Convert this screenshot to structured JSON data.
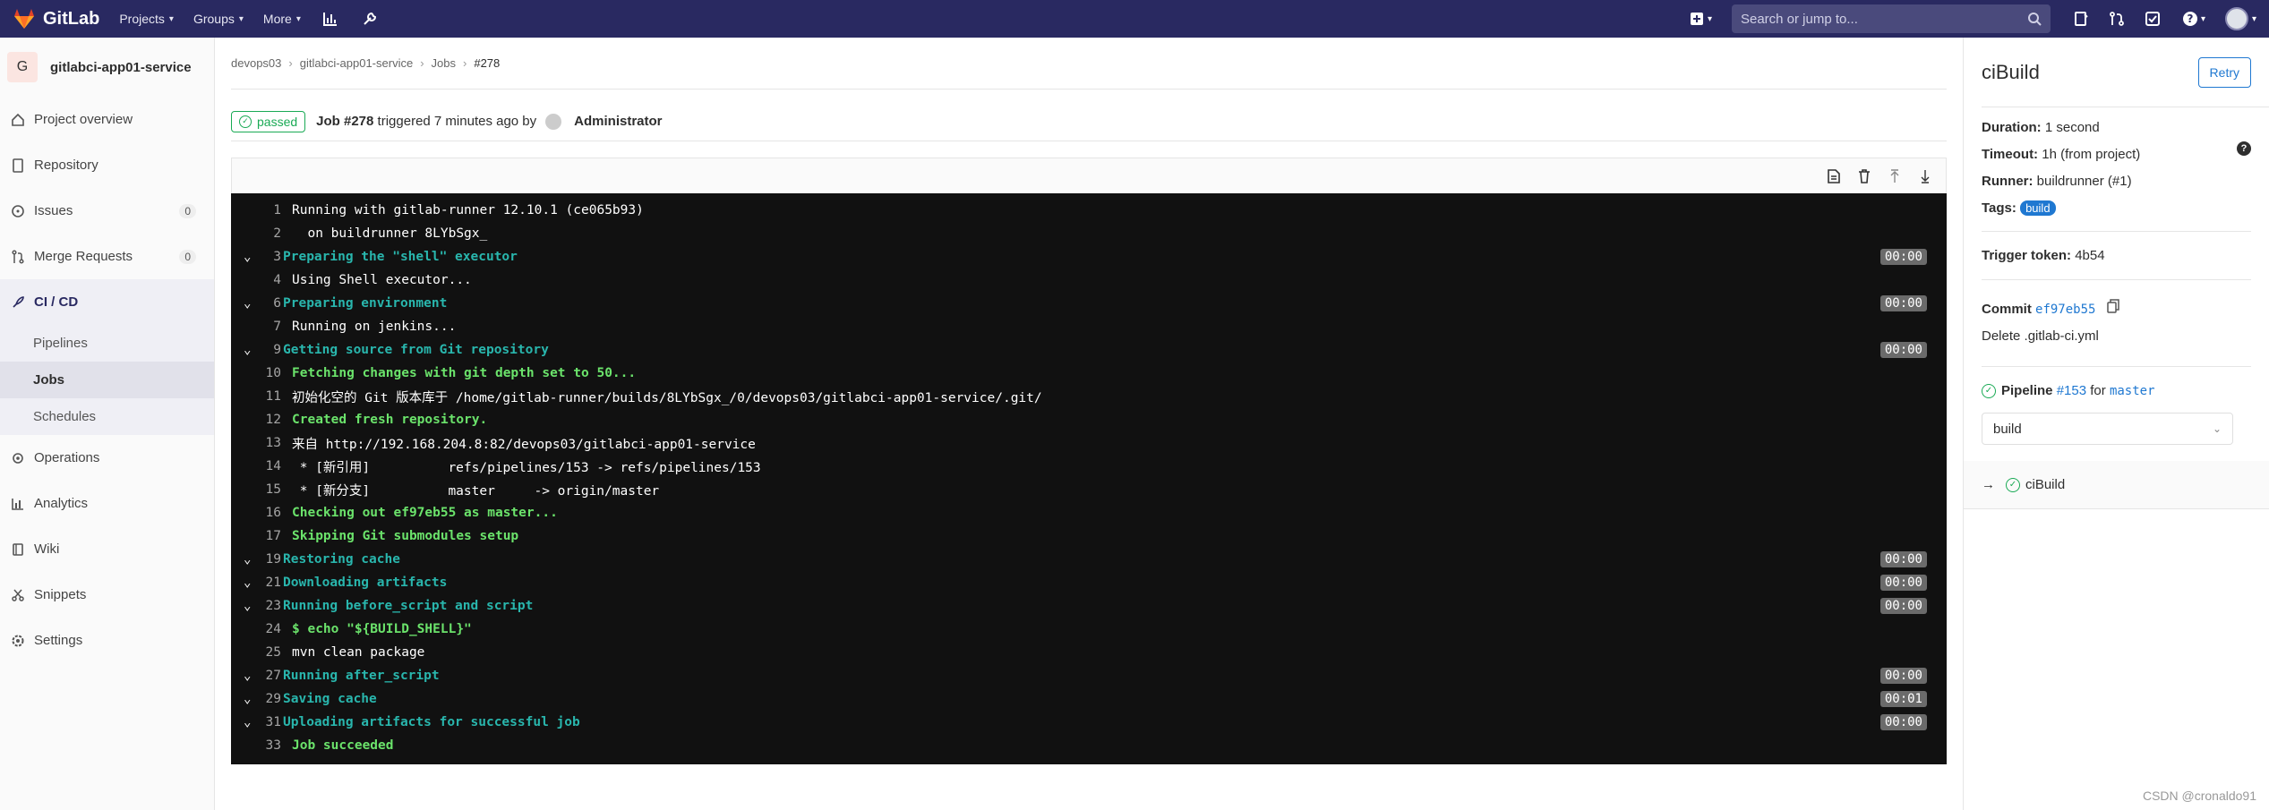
{
  "topbar": {
    "brand": "GitLab",
    "nav": [
      "Projects",
      "Groups",
      "More"
    ],
    "search_placeholder": "Search or jump to..."
  },
  "sidebar": {
    "project_initial": "G",
    "project_name": "gitlabci-app01-service",
    "items": [
      {
        "label": "Project overview"
      },
      {
        "label": "Repository"
      },
      {
        "label": "Issues",
        "count": "0"
      },
      {
        "label": "Merge Requests",
        "count": "0"
      },
      {
        "label": "CI / CD"
      },
      {
        "label": "Operations"
      },
      {
        "label": "Analytics"
      },
      {
        "label": "Wiki"
      },
      {
        "label": "Snippets"
      },
      {
        "label": "Settings"
      }
    ],
    "cicd_sub": [
      "Pipelines",
      "Jobs",
      "Schedules"
    ]
  },
  "breadcrumb": [
    "devops03",
    "gitlabci-app01-service",
    "Jobs",
    "#278"
  ],
  "job": {
    "status": "passed",
    "id": "Job #278",
    "triggered_text": "triggered 7 minutes ago by",
    "user": "Administrator"
  },
  "log": [
    {
      "n": "1",
      "text": "Running with gitlab-runner 12.10.1 (ce065b93)",
      "cls": "c-white"
    },
    {
      "n": "2",
      "text": "  on buildrunner 8LYbSgx_",
      "cls": "c-white"
    },
    {
      "n": "3",
      "text": "Preparing the \"shell\" executor",
      "cls": "c-cyan",
      "section": true,
      "time": "00:00"
    },
    {
      "n": "4",
      "text": "Using Shell executor...",
      "cls": "c-white"
    },
    {
      "n": "6",
      "text": "Preparing environment",
      "cls": "c-cyan",
      "section": true,
      "time": "00:00"
    },
    {
      "n": "7",
      "text": "Running on jenkins...",
      "cls": "c-white"
    },
    {
      "n": "9",
      "text": "Getting source from Git repository",
      "cls": "c-cyan",
      "section": true,
      "time": "00:00"
    },
    {
      "n": "10",
      "text": "Fetching changes with git depth set to 50...",
      "cls": "c-green"
    },
    {
      "n": "11",
      "text": "初始化空的 Git 版本库于 /home/gitlab-runner/builds/8LYbSgx_/0/devops03/gitlabci-app01-service/.git/",
      "cls": "c-white"
    },
    {
      "n": "12",
      "text": "Created fresh repository.",
      "cls": "c-green"
    },
    {
      "n": "13",
      "text": "来自 http://192.168.204.8:82/devops03/gitlabci-app01-service",
      "cls": "c-white"
    },
    {
      "n": "14",
      "text": " * [新引用]          refs/pipelines/153 -> refs/pipelines/153",
      "cls": "c-white"
    },
    {
      "n": "15",
      "text": " * [新分支]          master     -> origin/master",
      "cls": "c-white"
    },
    {
      "n": "16",
      "text": "Checking out ef97eb55 as master...",
      "cls": "c-green"
    },
    {
      "n": "17",
      "text": "Skipping Git submodules setup",
      "cls": "c-green"
    },
    {
      "n": "19",
      "text": "Restoring cache",
      "cls": "c-cyan",
      "section": true,
      "time": "00:00"
    },
    {
      "n": "21",
      "text": "Downloading artifacts",
      "cls": "c-cyan",
      "section": true,
      "time": "00:00"
    },
    {
      "n": "23",
      "text": "Running before_script and script",
      "cls": "c-cyan",
      "section": true,
      "time": "00:00"
    },
    {
      "n": "24",
      "text": "$ echo \"${BUILD_SHELL}\"",
      "cls": "c-green"
    },
    {
      "n": "25",
      "text": "mvn clean package",
      "cls": "c-white"
    },
    {
      "n": "27",
      "text": "Running after_script",
      "cls": "c-cyan",
      "section": true,
      "time": "00:00"
    },
    {
      "n": "29",
      "text": "Saving cache",
      "cls": "c-cyan",
      "section": true,
      "time": "00:01"
    },
    {
      "n": "31",
      "text": "Uploading artifacts for successful job",
      "cls": "c-cyan",
      "section": true,
      "time": "00:00"
    },
    {
      "n": "33",
      "text": "Job succeeded",
      "cls": "c-green"
    }
  ],
  "panel": {
    "title": "ciBuild",
    "retry": "Retry",
    "duration_label": "Duration:",
    "duration": "1 second",
    "timeout_label": "Timeout:",
    "timeout": "1h (from project)",
    "runner_label": "Runner:",
    "runner": "buildrunner (#1)",
    "tags_label": "Tags:",
    "tag": "build",
    "trigger_label": "Trigger token:",
    "trigger": "4b54",
    "commit_label": "Commit",
    "commit_sha": "ef97eb55",
    "commit_msg": "Delete .gitlab-ci.yml",
    "pipeline_label": "Pipeline",
    "pipeline_id": "#153",
    "for_text": "for",
    "branch": "master",
    "stage": "build",
    "job_name": "ciBuild"
  },
  "watermark": "CSDN @cronaldo91"
}
